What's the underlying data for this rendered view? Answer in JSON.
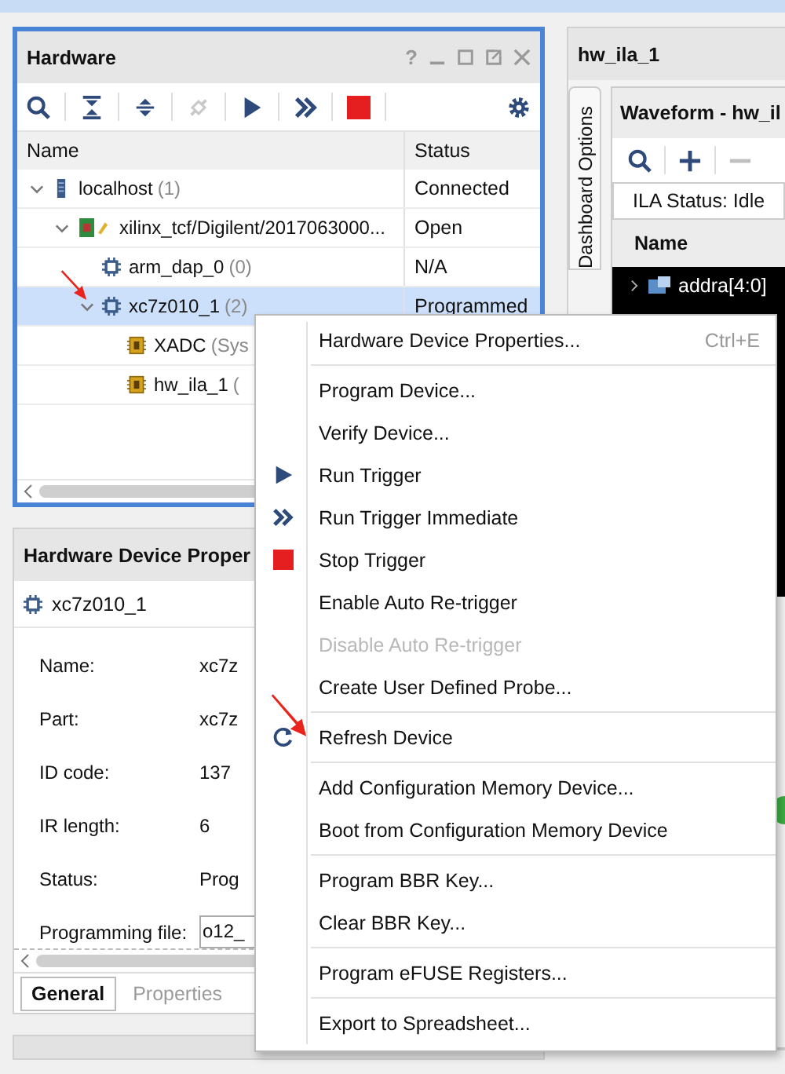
{
  "hardware": {
    "title": "Hardware",
    "controls": [
      "?"
    ],
    "columns": [
      "Name",
      "Status"
    ],
    "tree": [
      {
        "name": "localhost",
        "count": "(1)",
        "status": "Connected",
        "kind": "server",
        "expanded": true,
        "selected": false,
        "children": [
          {
            "name": "xilinx_tcf/Digilent/2017063000...",
            "status": "Open",
            "kind": "board",
            "expanded": true,
            "selected": false,
            "children": [
              {
                "name": "arm_dap_0",
                "count": "(0)",
                "status": "N/A",
                "kind": "chip",
                "selected": false
              },
              {
                "name": "xc7z010_1",
                "count": "(2)",
                "status": "Programmed",
                "kind": "chip",
                "expanded": true,
                "selected": true,
                "children": [
                  {
                    "name": "XADC",
                    "count": "(Sys",
                    "kind": "core",
                    "selected": false
                  },
                  {
                    "name": "hw_ila_1",
                    "count": "(",
                    "kind": "core",
                    "selected": false
                  }
                ]
              }
            ]
          }
        ]
      }
    ]
  },
  "properties": {
    "title": "Hardware Device Proper",
    "device": "xc7z010_1",
    "rows": [
      {
        "label": "Name:",
        "value": "xc7z"
      },
      {
        "label": "Part:",
        "value": "xc7z"
      },
      {
        "label": "ID code:",
        "value": "137"
      },
      {
        "label": "IR length:",
        "value": "6"
      },
      {
        "label": "Status:",
        "value": "Prog"
      },
      {
        "label": "Programming file:",
        "value": "o12_",
        "kind": "field"
      }
    ],
    "tabs": [
      {
        "label": "General",
        "selected": true
      },
      {
        "label": "Properties",
        "selected": false
      }
    ]
  },
  "ila": {
    "title": "hw_ila_1",
    "side_tab": "Dashboard Options",
    "waveform_title": "Waveform - hw_il",
    "status": "ILA Status:  Idle",
    "column": "Name",
    "signals": [
      "addra[4:0]"
    ]
  },
  "menu": {
    "groups": [
      [
        {
          "label": "Hardware Device Properties...",
          "shortcut": "Ctrl+E",
          "disabled": false
        }
      ],
      [
        {
          "label": "Program Device...",
          "disabled": false
        },
        {
          "label": "Verify Device...",
          "disabled": false
        },
        {
          "label": "Run Trigger",
          "kind": "run",
          "disabled": false
        },
        {
          "label": "Run Trigger Immediate",
          "kind": "run-immediate",
          "disabled": false
        },
        {
          "label": "Stop Trigger",
          "kind": "stop",
          "disabled": false
        },
        {
          "label": "Enable Auto Re-trigger",
          "disabled": false
        },
        {
          "label": "Disable Auto Re-trigger",
          "disabled": true
        },
        {
          "label": "Create User Defined Probe...",
          "disabled": false
        }
      ],
      [
        {
          "label": "Refresh Device",
          "kind": "refresh",
          "disabled": false
        }
      ],
      [
        {
          "label": "Add Configuration Memory Device...",
          "disabled": false
        },
        {
          "label": "Boot from Configuration Memory Device",
          "disabled": false
        }
      ],
      [
        {
          "label": "Program BBR Key...",
          "disabled": false
        },
        {
          "label": "Clear BBR Key...",
          "disabled": false
        }
      ],
      [
        {
          "label": "Program eFUSE Registers...",
          "disabled": false
        }
      ],
      [
        {
          "label": "Export to Spreadsheet...",
          "disabled": false
        }
      ]
    ]
  }
}
